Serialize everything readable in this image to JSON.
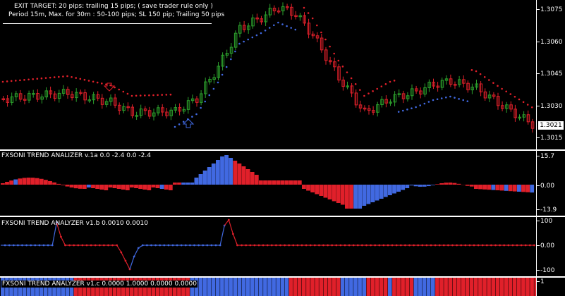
{
  "main_chart": {
    "annotation_line1": "EXIT TARGET: 20 pips: trailing 15 pips; ( save trader rule only )",
    "annotation_line2": "Period 15m, Max. for 30m  : 50-100 pips; SL 150 pip; Trailing 50 pips",
    "price_ticks": [
      "1.3075",
      "1.3060",
      "1.3045",
      "1.3030",
      "1.3015"
    ],
    "current_price": "1.3021",
    "colors": {
      "bull": "#2ca02c",
      "bear": "#e0202a",
      "dot_up": "#4169e1",
      "dot_down": "#e0202a",
      "arrow_up": "#4169e1",
      "arrow_down": "#e0202a"
    }
  },
  "indicator_a": {
    "title": "FXSONI TREND ANALIZER v.1a 0.0 -2.4 0.0 -2.4",
    "ticks": [
      "15.7",
      "0.00",
      "-13.9"
    ],
    "colors": {
      "up": "#4169e1",
      "down": "#e0202a"
    }
  },
  "indicator_b": {
    "title": "FXSONI TREND ANALYZER v1.b 0.0010 0.0010",
    "ticks": [
      "100",
      "0.00",
      "-100"
    ],
    "colors": {
      "up": "#4169e1",
      "down": "#e0202a"
    }
  },
  "indicator_c": {
    "title": "FXSONI TREND ANALYZER v1.c 0.0000 1.0000 0.0000 0.0000",
    "ticks": [
      "1"
    ],
    "colors": {
      "up": "#4169e1",
      "down": "#e0202a"
    }
  }
}
